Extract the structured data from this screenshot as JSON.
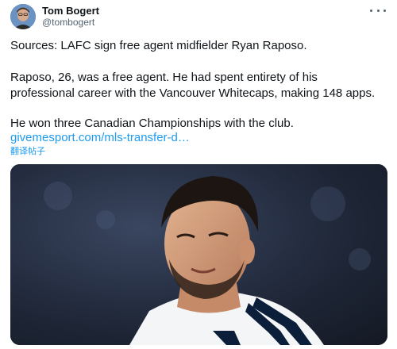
{
  "author": {
    "name": "Tom Bogert",
    "handle": "@tombogert"
  },
  "tweet": {
    "line1": "Sources: LAFC sign free agent midfielder Ryan Raposo.",
    "line2": "Raposo, 26, was a free agent. He had spent entirety of his professional career with the Vancouver Whitecaps, making 148 apps.",
    "line3": "He won three Canadian Championships with the club.",
    "link": "givemesport.com/mls-transfer-d…",
    "translate": "翻译帖子"
  },
  "colors": {
    "link": "#1d9bf0",
    "secondary_text": "#536471",
    "text": "#0f1419"
  },
  "icons": {
    "more": "more-icon"
  }
}
